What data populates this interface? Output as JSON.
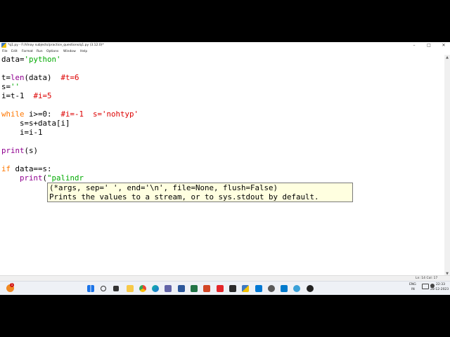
{
  "window": {
    "title": "*q1.py - F:/Vinay subjects/practice_questions/q1.py (3.12.0)*"
  },
  "menu": {
    "items": [
      "File",
      "Edit",
      "Format",
      "Run",
      "Options",
      "Window",
      "Help"
    ]
  },
  "editor": {
    "lines": [
      "data='python'",
      "",
      "t=len(data)  #t=6",
      "s=''",
      "i=t-1  #i=5",
      "",
      "while i>=0:  #i=-1  s='nohtyp'",
      "    s=s+data[i]",
      "    i=i-1",
      "",
      "print(s)",
      "",
      "if data==s:",
      "    print(\"palindr"
    ]
  },
  "calltip": {
    "signature": "(*args, sep=' ', end='\\n', file=None, flush=False)",
    "description": "Prints the values to a stream, or to sys.stdout by default."
  },
  "statusbar": {
    "position": "Ln: 14  Col: 17"
  },
  "taskbar": {
    "weather_badge": "1",
    "language": "ENG",
    "region": "IN",
    "time": "22:33",
    "date": "28-12-2023",
    "app_icons": [
      "start-icon",
      "search-icon",
      "task-view-icon",
      "file-explorer-icon",
      "chrome-icon",
      "edge-icon",
      "teams-icon",
      "word-icon",
      "excel-icon",
      "powerpoint-icon",
      "acrobat-icon",
      "terminal-icon",
      "python-idle-icon",
      "photos-icon",
      "settings-icon",
      "vscode-icon",
      "other-app-icon",
      "media-icon"
    ]
  },
  "colors": {
    "keyword": "#ff7700",
    "builtin": "#900090",
    "string": "#00aa00",
    "comment": "#dd0000",
    "calltip_bg": "#ffffe0"
  }
}
